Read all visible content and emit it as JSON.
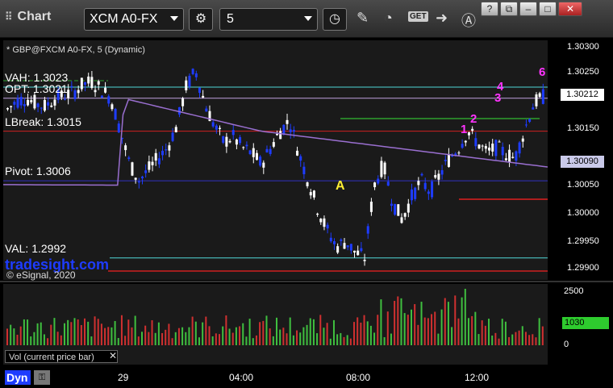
{
  "window": {
    "title": "Chart"
  },
  "toolbar": {
    "symbol": "XCM A0-FX",
    "interval": "5",
    "get_label": "GET"
  },
  "chart": {
    "header": "* GBP@FXCM A0-FX, 5 (Dynamic)",
    "watermark": "tradesight.com",
    "copyright": "© eSignal, 2020",
    "levels": [
      {
        "label": "VAH: 1.3023",
        "value": 1.3023,
        "color": "#4fd8d8"
      },
      {
        "label": "OPT: 1.3021",
        "value": 1.3021,
        "color": "#c0a0e0"
      },
      {
        "label": "LBreak: 1.3015",
        "value": 1.3015,
        "color": "#d02020"
      },
      {
        "label": "Pivot: 1.3006",
        "value": 1.3006,
        "color": "#3030c0"
      },
      {
        "label": "VAL: 1.2992",
        "value": 1.2992,
        "color": "#4fd8d8"
      }
    ],
    "markers": [
      {
        "text": "A",
        "color": "#ffee33"
      },
      {
        "text": "1",
        "color": "#ff2a2a"
      },
      {
        "text": "1",
        "color": "#ff33ff"
      },
      {
        "text": "2",
        "color": "#ff33ff"
      },
      {
        "text": "3",
        "color": "#ff33ff"
      },
      {
        "text": "4",
        "color": "#ff33ff"
      },
      {
        "text": "6",
        "color": "#ff33ff"
      }
    ],
    "price_ticks": [
      "1.30300",
      "1.30250",
      "1.30200",
      "1.30150",
      "1.30100",
      "1.30050",
      "1.30000",
      "1.29950",
      "1.29900"
    ],
    "last_price": "1.30212",
    "vwap_price": "1.30090",
    "colors": {
      "up": "#ffffff",
      "down": "#1e3cff",
      "vwap": "#9a6fd0",
      "background": "#1a1a1a"
    }
  },
  "volume": {
    "label": "Vol (current price bar)",
    "ticks": [
      "2500",
      "0"
    ],
    "current": "1030",
    "colors": {
      "up": "#3fbf3f",
      "down": "#d03030"
    }
  },
  "xaxis": {
    "ticks": [
      "29",
      "04:00",
      "08:00",
      "12:00"
    ],
    "mode_label": "Dyn"
  }
}
